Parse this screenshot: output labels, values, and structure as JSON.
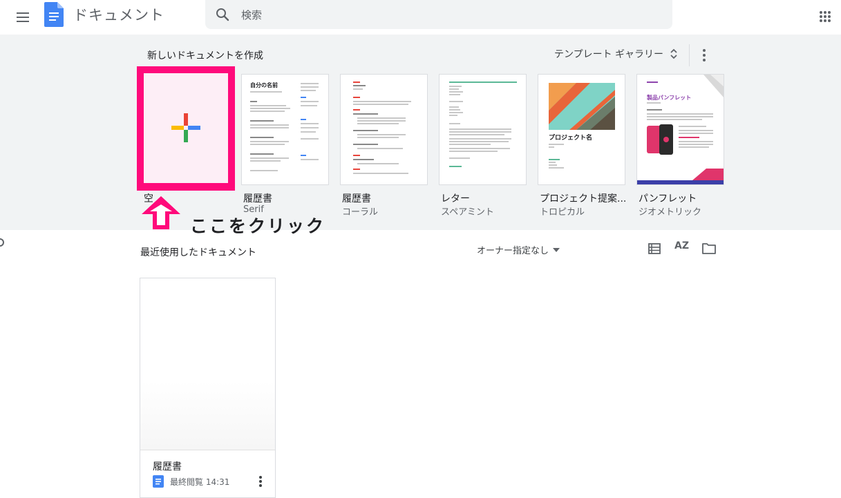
{
  "header": {
    "app_title": "ドキュメント",
    "search_placeholder": "検索"
  },
  "gallery": {
    "title": "新しいドキュメントを作成",
    "template_gallery_label": "テンプレート ギャラリー",
    "templates": [
      {
        "name": "空",
        "subtitle": ""
      },
      {
        "name": "履歴書",
        "subtitle": "Serif",
        "thumb_heading": "自分の名前"
      },
      {
        "name": "履歴書",
        "subtitle": "コーラル"
      },
      {
        "name": "レター",
        "subtitle": "スペアミント"
      },
      {
        "name": "プロジェクト提案...",
        "subtitle": "トロピカル",
        "thumb_heading": "プロジェクト名"
      },
      {
        "name": "パンフレット",
        "subtitle": "ジオメトリック",
        "thumb_heading": "製品パンフレット"
      }
    ]
  },
  "annotation": {
    "text": "ここをクリック"
  },
  "recent": {
    "title": "最近使用したドキュメント",
    "owner_filter": "オーナー指定なし",
    "sort_label": "AZ",
    "documents": [
      {
        "title": "履歴書",
        "meta": "最終閲覧 14:31"
      }
    ]
  },
  "colors": {
    "highlight": "#ff0a7b",
    "gallery_bg": "#f1f3f4",
    "docs_blue": "#4285f4"
  }
}
